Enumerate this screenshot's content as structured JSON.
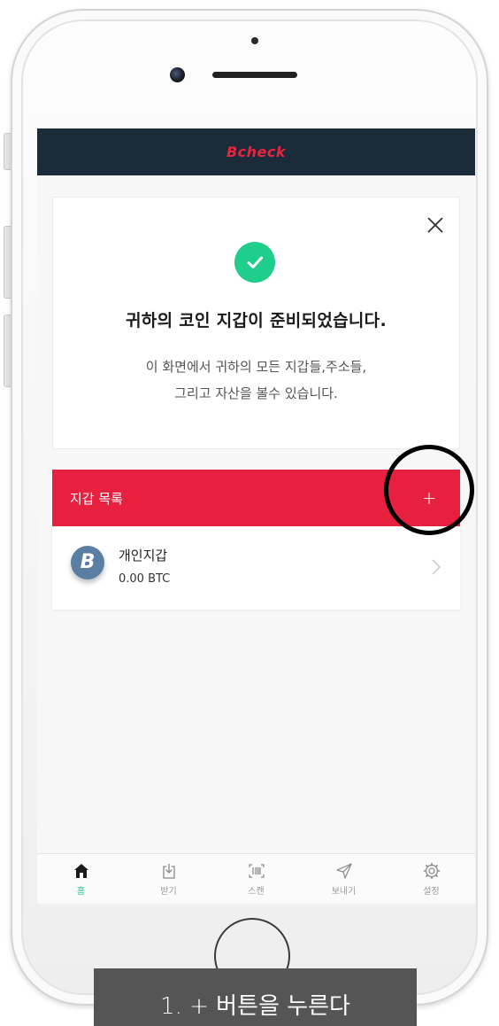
{
  "app": {
    "logo_text": "Bcheck",
    "brand_color": "#e8203f",
    "header_color": "#1c2b3a",
    "accent_color": "#1fce8a"
  },
  "welcome_card": {
    "title": "귀하의 코인 지갑이 준비되었습니다.",
    "description_line1": "이 화면에서 귀하의 모든 지갑들,주소들,",
    "description_line2": "그리고 자산을 볼수 있습니다.",
    "close_icon": "close-icon",
    "status_icon": "check-circle-icon"
  },
  "wallet_list": {
    "title": "지갑 목록",
    "add_label": "+",
    "items": [
      {
        "name": "개인지갑",
        "balance": "0.00 BTC",
        "icon": "bitcoin-icon"
      }
    ]
  },
  "tabbar": {
    "items": [
      {
        "label": "홈",
        "icon": "home-icon",
        "active": true
      },
      {
        "label": "받기",
        "icon": "receive-icon",
        "active": false
      },
      {
        "label": "스캔",
        "icon": "scan-icon",
        "active": false
      },
      {
        "label": "보내기",
        "icon": "send-icon",
        "active": false
      },
      {
        "label": "설정",
        "icon": "settings-icon",
        "active": false
      }
    ]
  },
  "caption": {
    "text": "1. + 버튼을 누른다"
  }
}
